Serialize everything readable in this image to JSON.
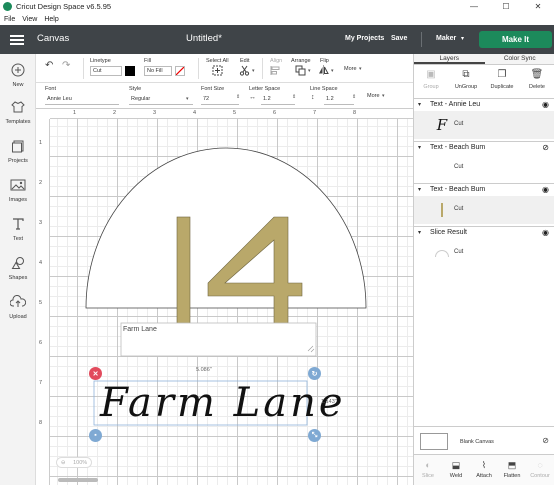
{
  "window": {
    "title": "Cricut Design Space  v6.5.95",
    "controls": [
      "—",
      "☐",
      "✕"
    ]
  },
  "menu": [
    "File",
    "View",
    "Help"
  ],
  "header": {
    "section": "Canvas",
    "doc_title": "Untitled*",
    "my_projects": "My Projects",
    "save": "Save",
    "machine": "Maker",
    "make_it": "Make It"
  },
  "toolbar1": {
    "linetype_label": "Linetype",
    "linetype_value": "Cut",
    "fill_label": "Fill",
    "fill_value": "No Fill",
    "select_all": "Select All",
    "edit": "Edit",
    "align": "Align",
    "arrange": "Arrange",
    "flip": "Flip",
    "more": "More"
  },
  "toolbar2": {
    "font_label": "Font",
    "font_value": "Annie Leu",
    "style_label": "Style",
    "style_value": "Regular",
    "font_size_label": "Font Size",
    "font_size_value": "72",
    "letter_space_label": "Letter Space",
    "letter_space_value": "1.2",
    "line_space_label": "Line Space",
    "line_space_value": "1.2",
    "more": "More"
  },
  "sidebar": [
    {
      "label": "New",
      "icon": "plus-icon"
    },
    {
      "label": "Templates",
      "icon": "shirt-icon"
    },
    {
      "label": "Projects",
      "icon": "projects-icon"
    },
    {
      "label": "Images",
      "icon": "image-icon"
    },
    {
      "label": "Text",
      "icon": "text-icon"
    },
    {
      "label": "Shapes",
      "icon": "shapes-icon"
    },
    {
      "label": "Upload",
      "icon": "upload-icon"
    }
  ],
  "rulers": {
    "top": [
      "1",
      "2",
      "3",
      "4",
      "5",
      "6",
      "7",
      "8"
    ],
    "left": [
      "1",
      "2",
      "3",
      "4",
      "5",
      "6",
      "7",
      "8"
    ]
  },
  "canvas": {
    "big_number": "14",
    "small_text": "Farm Lane",
    "script_text": "Farm Lane",
    "width_dim": "5.086\"",
    "height_dim": "1.143\"",
    "zoom": "100%"
  },
  "panel": {
    "tabs": [
      "Layers",
      "Color Sync"
    ],
    "actions": [
      "Group",
      "UnGroup",
      "Duplicate",
      "Delete"
    ],
    "layers": [
      {
        "title": "Text - Annie Leu",
        "operation": "Cut",
        "thumb": "F"
      },
      {
        "title": "Text - Beach Bum",
        "operation": "Cut",
        "thumb": ""
      },
      {
        "title": "Text - Beach Bum",
        "operation": "Cut",
        "thumb": ""
      },
      {
        "title": "Slice Result",
        "operation": "Cut",
        "thumb": ""
      }
    ],
    "blank_canvas": "Blank Canvas",
    "bottom_actions": [
      "Slice",
      "Weld",
      "Attach",
      "Flatten",
      "Contour"
    ]
  },
  "colors": {
    "header_bg": "#3f4448",
    "make_it": "#1c8a5b",
    "gold_number": "#b9a86a",
    "handle_red": "#e24b5d",
    "handle_blue": "#7fa9d3"
  }
}
